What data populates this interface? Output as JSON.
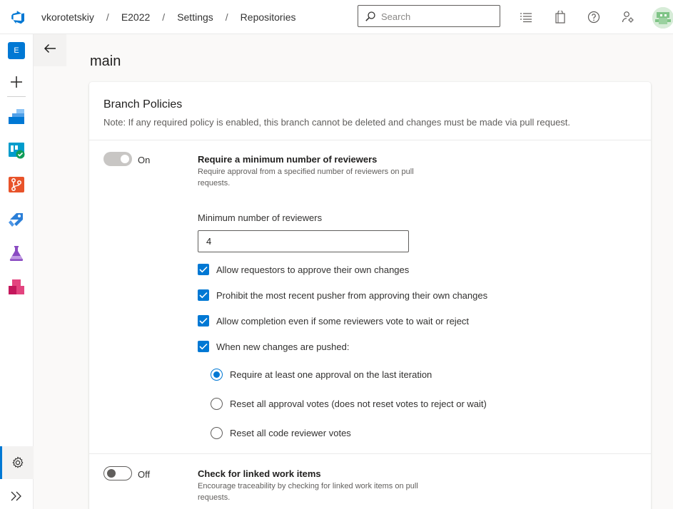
{
  "header": {
    "breadcrumbs": [
      "vkorotetskiy",
      "E2022",
      "Settings",
      "Repositories"
    ],
    "breadcrumb_separator": "/",
    "search_placeholder": "Search",
    "icons": [
      "azure-devops-logo-icon",
      "list-icon",
      "shopping-bag-icon",
      "help-icon",
      "user-settings-icon"
    ],
    "accent_color": "#0078d4"
  },
  "rail": {
    "org_initial": "E",
    "items": [
      "add-icon",
      "boards-icon",
      "repos-icon",
      "pipelines-icon",
      "test-plans-icon",
      "artifacts-icon"
    ],
    "footer": [
      "project-settings-icon",
      "expand-icon"
    ]
  },
  "page": {
    "title": "main",
    "back_icon": "arrow-left-icon"
  },
  "card": {
    "title": "Branch Policies",
    "note": "Note: If any required policy is enabled, this branch cannot be deleted and changes must be made via pull request."
  },
  "policies": [
    {
      "toggle_label": "On",
      "enabled": true,
      "title": "Require a minimum number of reviewers",
      "description": "Require approval from a specified number of reviewers on pull requests."
    },
    {
      "toggle_label": "Off",
      "enabled": false,
      "title": "Check for linked work items",
      "description": "Encourage traceability by checking for linked work items on pull requests."
    }
  ],
  "reviewers": {
    "field_label": "Minimum number of reviewers",
    "value": "4",
    "checkboxes": [
      {
        "label": "Allow requestors to approve their own changes",
        "checked": true
      },
      {
        "label": "Prohibit the most recent pusher from approving their own changes",
        "checked": true
      },
      {
        "label": "Allow completion even if some reviewers vote to wait or reject",
        "checked": true
      },
      {
        "label": "When new changes are pushed:",
        "checked": true
      }
    ],
    "radios": [
      {
        "label": "Require at least one approval on the last iteration",
        "selected": true
      },
      {
        "label": "Reset all approval votes (does not reset votes to reject or wait)",
        "selected": false
      },
      {
        "label": "Reset all code reviewer votes",
        "selected": false
      }
    ]
  }
}
